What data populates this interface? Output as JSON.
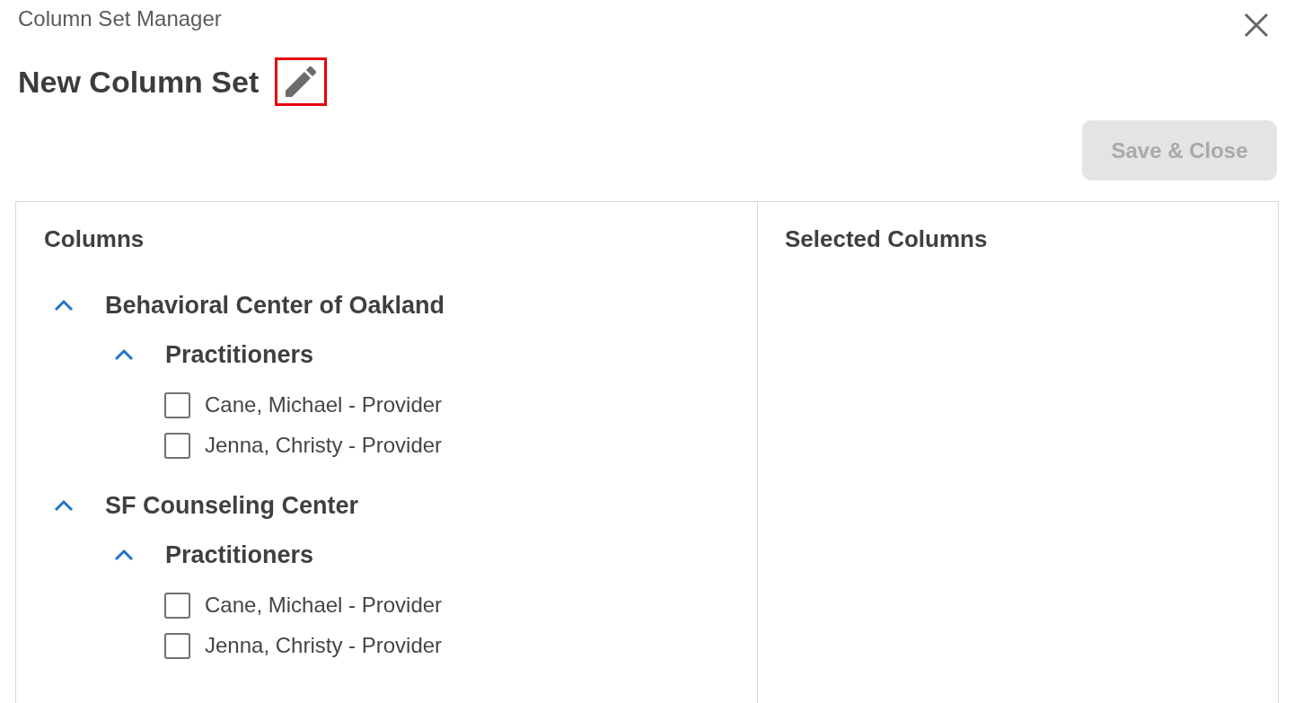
{
  "dialog": {
    "title": "Column Set Manager"
  },
  "column_set": {
    "name": "New Column Set",
    "edit_highlighted": true
  },
  "save_button": {
    "label": "Save & Close",
    "disabled": true
  },
  "columns_panel": {
    "heading": "Columns",
    "tree": [
      {
        "label": "Behavioral Center of Oakland",
        "expanded": true,
        "children": [
          {
            "label": "Practitioners",
            "expanded": true,
            "children": [
              {
                "label": "Cane, Michael - Provider",
                "checked": false
              },
              {
                "label": "Jenna, Christy - Provider",
                "checked": false
              }
            ]
          }
        ]
      },
      {
        "label": "SF Counseling Center",
        "expanded": true,
        "children": [
          {
            "label": "Practitioners",
            "expanded": true,
            "children": [
              {
                "label": "Cane, Michael - Provider",
                "checked": false
              },
              {
                "label": "Jenna, Christy - Provider",
                "checked": false
              }
            ]
          }
        ]
      }
    ]
  },
  "selected_panel": {
    "heading": "Selected Columns"
  }
}
